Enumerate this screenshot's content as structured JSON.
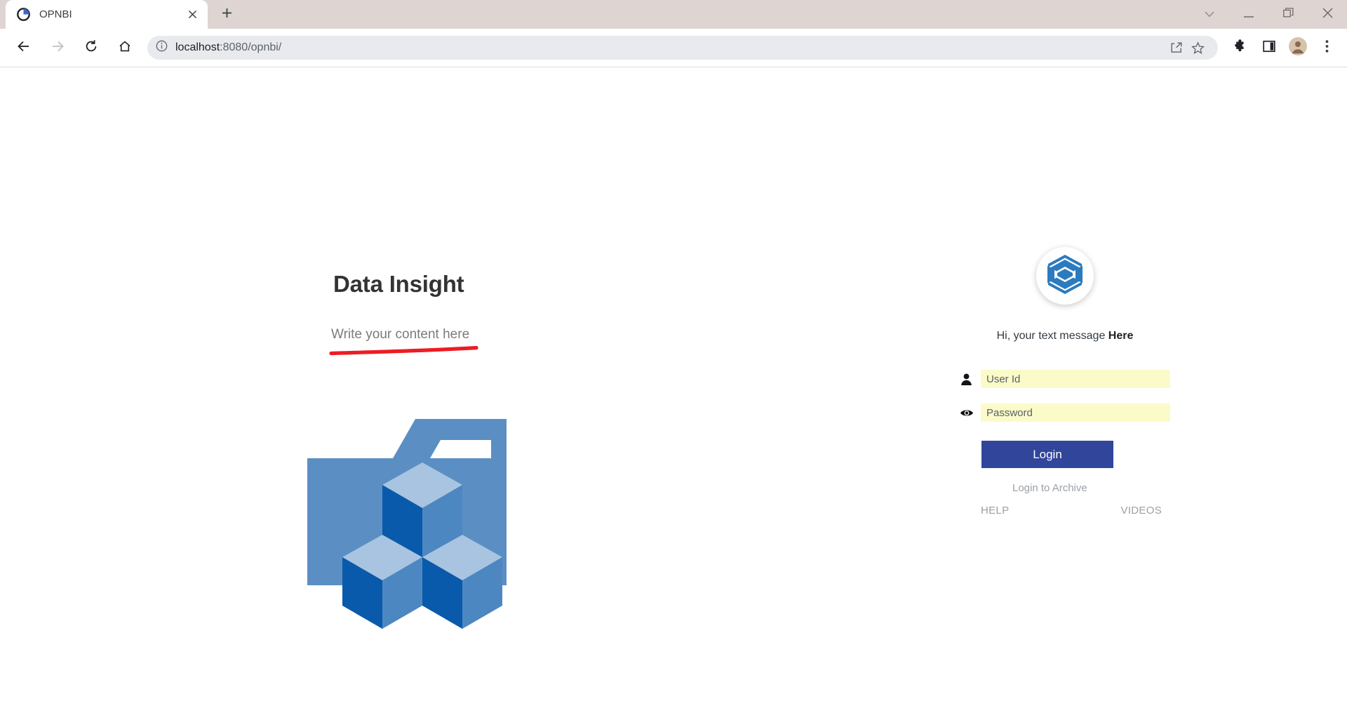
{
  "browser": {
    "tab": {
      "title": "OPNBI",
      "favicon_icon": "pie-chart-favicon",
      "close_icon": "close-icon"
    },
    "new_tab_icon": "plus-icon",
    "window_controls": [
      {
        "name": "tab-search",
        "icon": "chevron-down-icon"
      },
      {
        "name": "minimize",
        "icon": "minimize-icon"
      },
      {
        "name": "maximize",
        "icon": "restore-icon"
      },
      {
        "name": "close",
        "icon": "close-icon"
      }
    ],
    "nav": [
      {
        "name": "back",
        "icon": "arrow-left-icon",
        "enabled": true
      },
      {
        "name": "forward",
        "icon": "arrow-right-icon",
        "enabled": false
      },
      {
        "name": "reload",
        "icon": "reload-icon",
        "enabled": true
      },
      {
        "name": "home",
        "icon": "home-icon",
        "enabled": true
      }
    ],
    "omnibox": {
      "info_icon": "info-circle-icon",
      "host": "localhost",
      "path": ":8080/opnbi/",
      "full_url": "localhost:8080/opnbi/",
      "share_icon": "share-icon",
      "bookmark_icon": "star-icon"
    },
    "toolbar_icons": [
      {
        "name": "extensions",
        "icon": "puzzle-icon"
      },
      {
        "name": "side-panel",
        "icon": "panel-icon"
      },
      {
        "name": "profile",
        "icon": "account-avatar-icon"
      },
      {
        "name": "menu",
        "icon": "three-dot-menu-icon"
      }
    ]
  },
  "page": {
    "title": "Data Insight",
    "subtitle": "Write your content here",
    "underline_color": "#ed1c24",
    "illustration": {
      "name": "data-cubes-illustration",
      "folder_color": "#5b8fc4",
      "cube_top_color": "#a8c4e0",
      "cube_left_color": "#0a5aab",
      "cube_right_color": "#4d87c2"
    }
  },
  "login": {
    "avatar_icon": "webpack-cube-logo-icon",
    "avatar_color": "#2b7bbf",
    "greeting_prefix": "Hi, your text message ",
    "greeting_emphasis": "Here",
    "fields": [
      {
        "name": "user-id",
        "icon": "person-icon",
        "placeholder": "User Id",
        "value": ""
      },
      {
        "name": "password",
        "icon": "eye-icon",
        "placeholder": "Password",
        "value": ""
      }
    ],
    "submit_label": "Login",
    "submit_color": "#31459b",
    "archive_link": "Login to Archive",
    "help_label": "HELP",
    "videos_label": "VIDEOS"
  }
}
